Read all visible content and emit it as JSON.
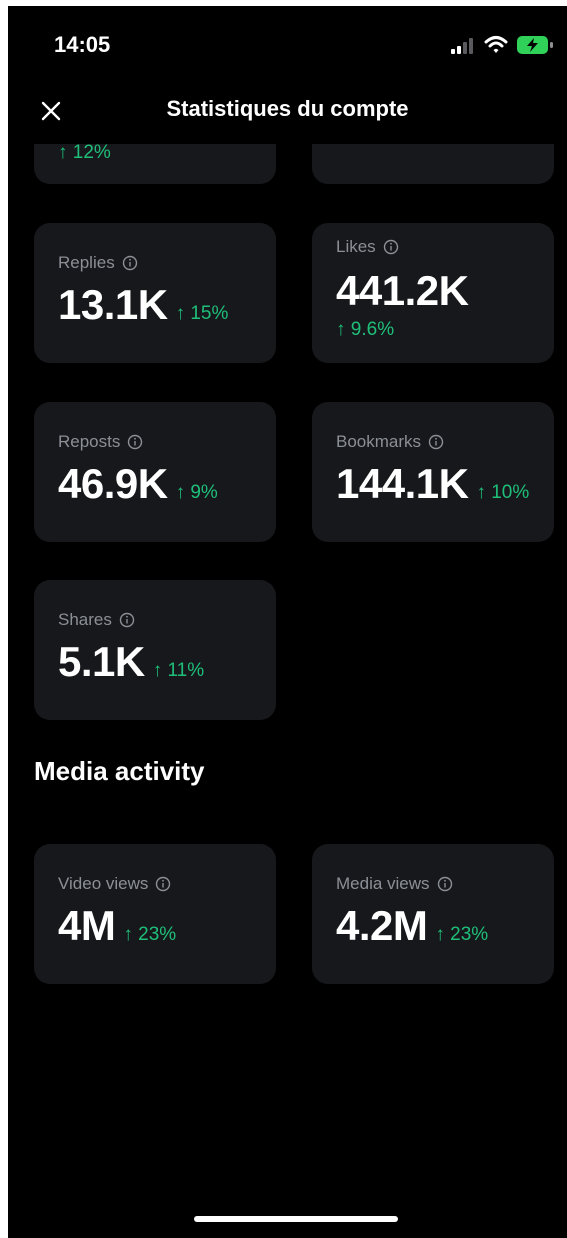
{
  "status_bar": {
    "time": "14:05"
  },
  "header": {
    "title": "Statistiques du compte"
  },
  "top_cards": {
    "left_change": "↑ 12%"
  },
  "engagement_cards": [
    {
      "label": "Replies",
      "value": "13.1K",
      "change": "↑ 15%"
    },
    {
      "label": "Likes",
      "value": "441.2K",
      "change": "↑ 9.6%"
    },
    {
      "label": "Reposts",
      "value": "46.9K",
      "change": "↑ 9%"
    },
    {
      "label": "Bookmarks",
      "value": "144.1K",
      "change": "↑ 10%"
    },
    {
      "label": "Shares",
      "value": "5.1K",
      "change": "↑ 11%"
    }
  ],
  "media_section": {
    "title": "Media activity",
    "cards": [
      {
        "label": "Video views",
        "value": "4M",
        "change": "↑ 23%"
      },
      {
        "label": "Media views",
        "value": "4.2M",
        "change": "↑ 23%"
      }
    ]
  },
  "colors": {
    "background": "#000000",
    "card": "#17181b",
    "positive": "#1fbf7a",
    "label": "#8b8f96"
  },
  "icons": [
    "close-icon",
    "info-icon",
    "signal-icon",
    "wifi-icon",
    "battery-icon"
  ]
}
